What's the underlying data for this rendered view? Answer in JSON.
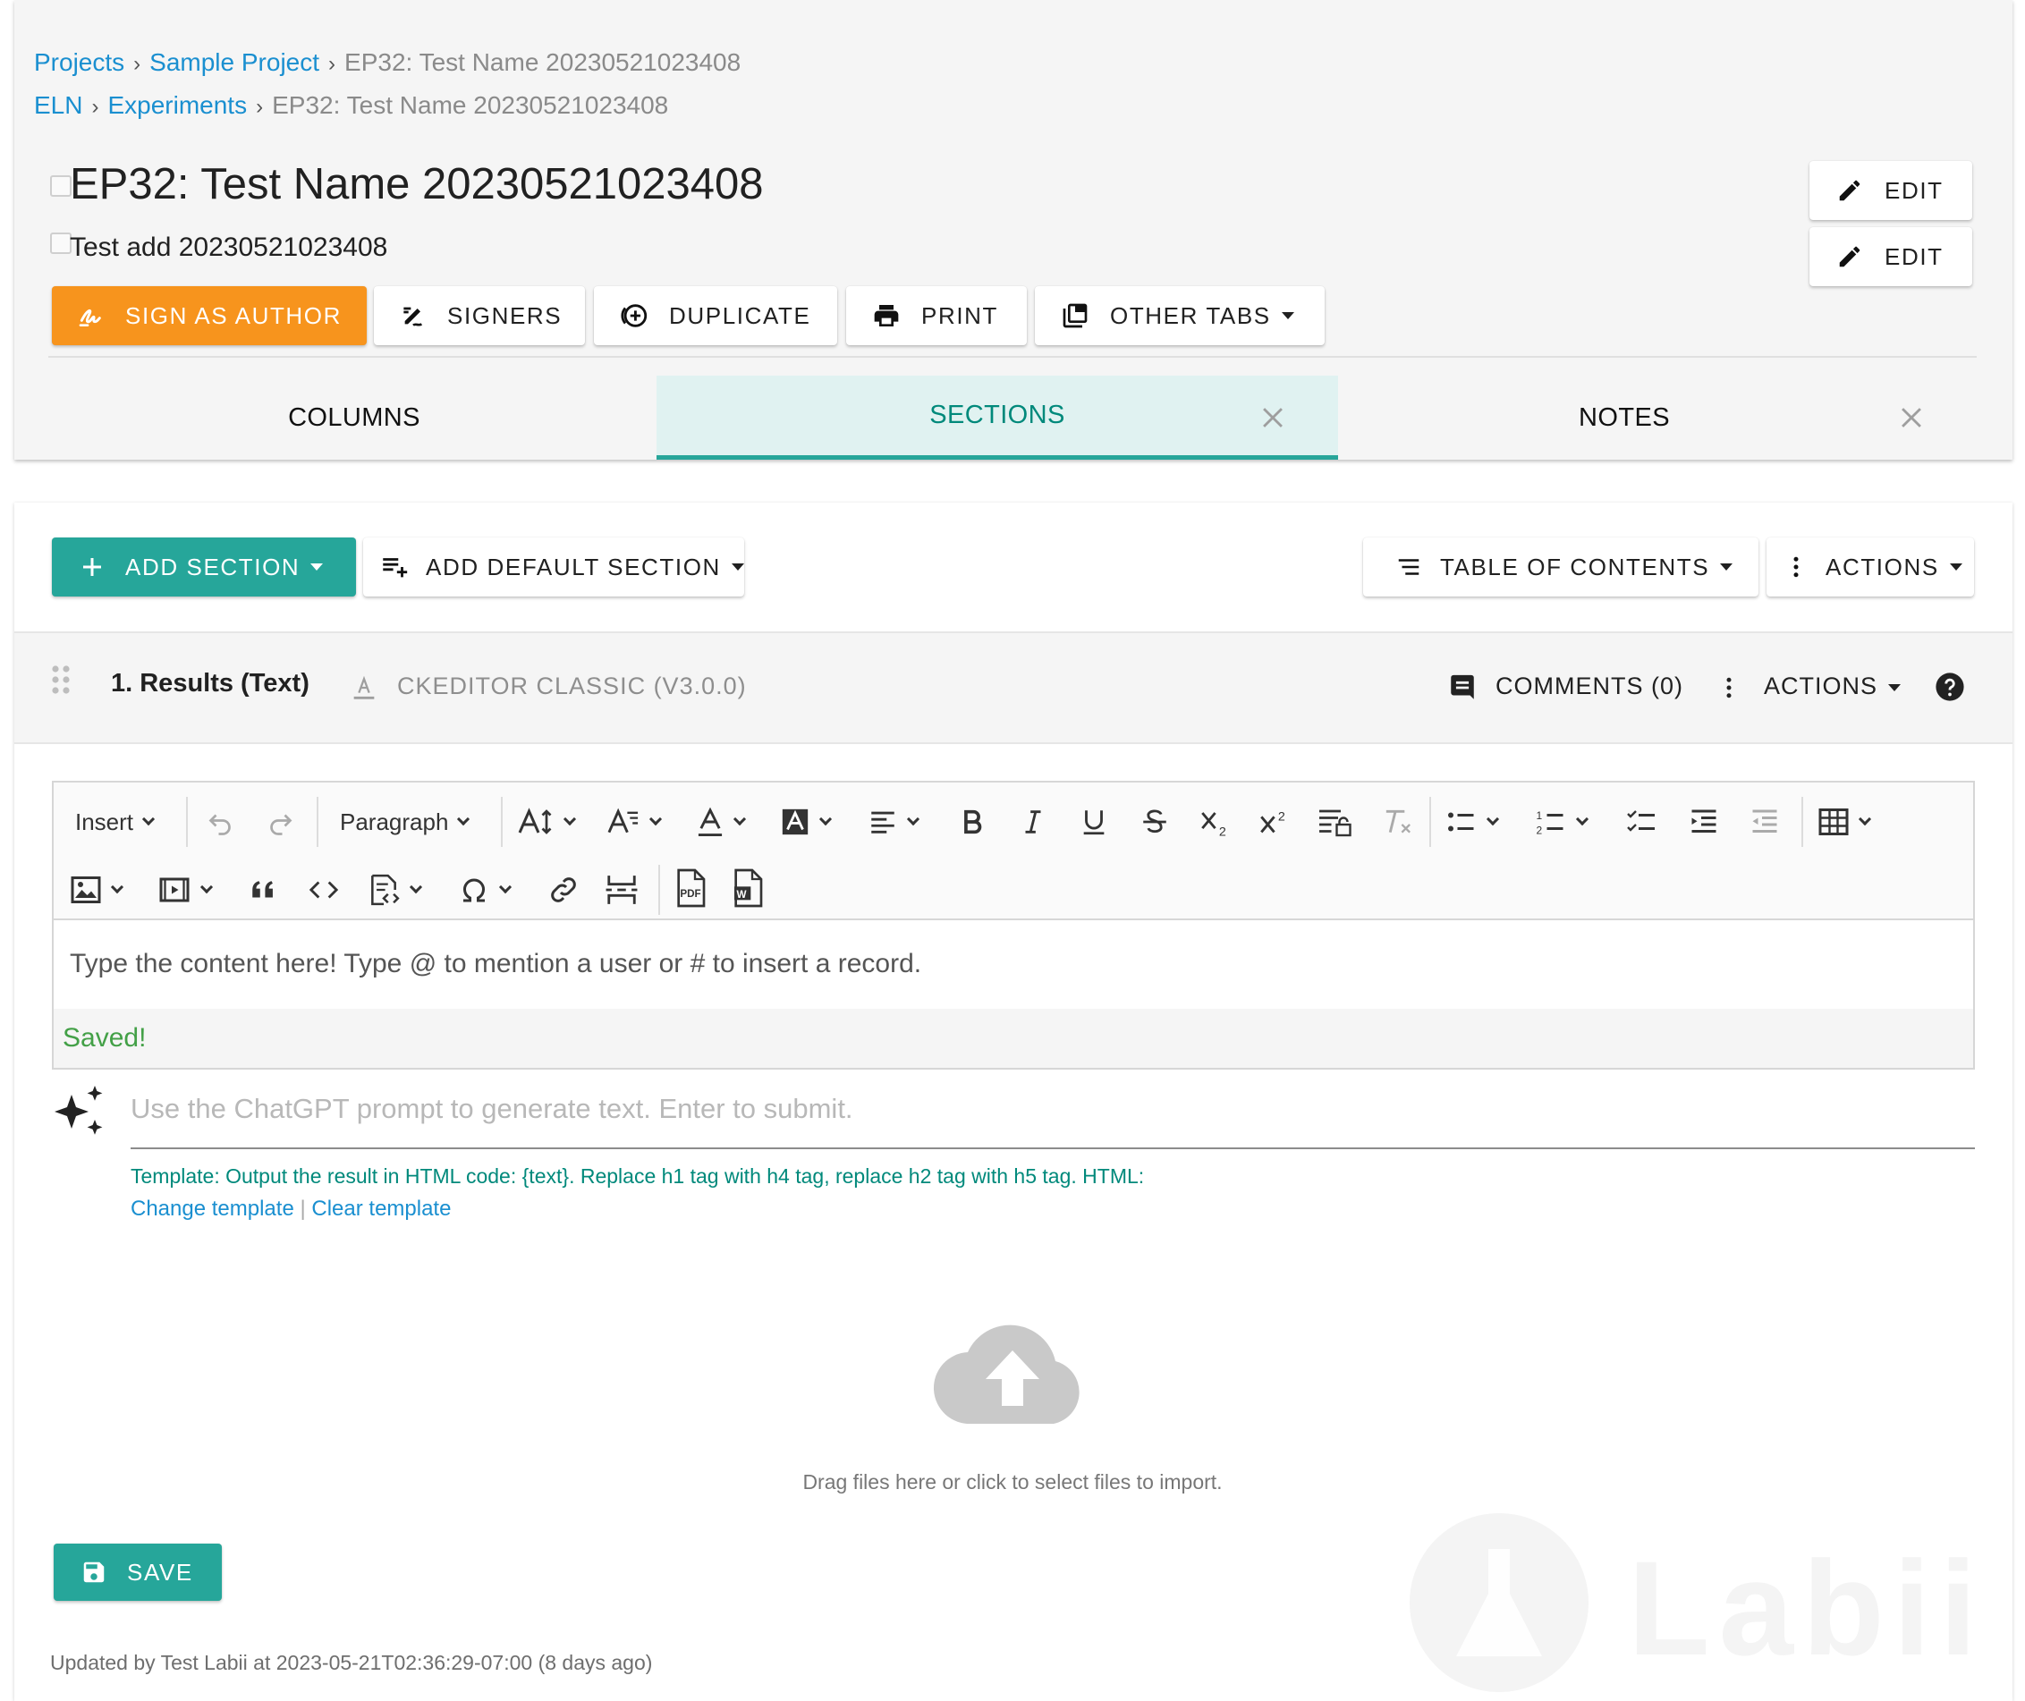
{
  "breadcrumbs": {
    "row1": [
      "Projects",
      "Sample Project",
      "EP32: Test Name 20230521023408"
    ],
    "row2": [
      "ELN",
      "Experiments",
      "EP32: Test Name 20230521023408"
    ]
  },
  "page": {
    "title": "EP32: Test Name 20230521023408",
    "subtitle": "Test add 20230521023408",
    "edit_title_label": "EDIT",
    "edit_subtitle_label": "EDIT"
  },
  "action_buttons": {
    "sign_as_author": "SIGN AS AUTHOR",
    "signers": "SIGNERS",
    "duplicate": "DUPLICATE",
    "print": "PRINT",
    "other_tabs": "OTHER TABS"
  },
  "tabs": [
    {
      "label": "COLUMNS",
      "active": false
    },
    {
      "label": "SECTIONS",
      "active": true
    },
    {
      "label": "NOTES",
      "active": false
    }
  ],
  "sections_toolbar": {
    "add_section": "ADD SECTION",
    "add_default_section": "ADD DEFAULT SECTION",
    "table_of_contents": "TABLE OF CONTENTS",
    "actions": "ACTIONS"
  },
  "section": {
    "title": "1. Results (Text)",
    "editor_type": "CKEDITOR CLASSIC (V3.0.0)",
    "comments": "COMMENTS (0)",
    "actions": "ACTIONS"
  },
  "editor": {
    "insert_label": "Insert",
    "paragraph_label": "Paragraph",
    "placeholder": "Type the content here! Type @ to mention a user or # to insert a record.",
    "status": "Saved!"
  },
  "chatgpt": {
    "placeholder": "Use the ChatGPT prompt to generate text. Enter to submit.",
    "template_text": "Template: Output the result in HTML code: {text}. Replace h1 tag with h4 tag, replace h2 tag with h5 tag. HTML:",
    "change_template": "Change template",
    "clear_template": "Clear template",
    "separator": "|"
  },
  "dropzone": {
    "text": "Drag files here or click to select files to import."
  },
  "save_label": "SAVE",
  "footer": {
    "updated": "Updated by Test Labii at 2023-05-21T02:36:29-07:00 (8 days ago)",
    "watermark": "Labii"
  },
  "colors": {
    "link": "#1a8fd0",
    "accent_teal": "#26a69a",
    "accent_orange": "#f7941d",
    "saved_green": "#43a047"
  }
}
